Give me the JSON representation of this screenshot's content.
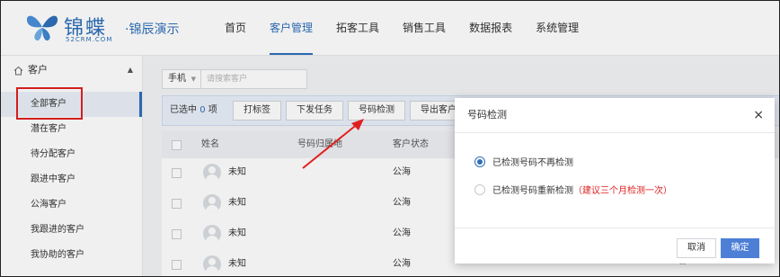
{
  "header": {
    "brand": "锦蝶",
    "brand_sub": "52CRM.COM",
    "product": "·锦辰演示",
    "nav": [
      "首页",
      "客户管理",
      "拓客工具",
      "销售工具",
      "数据报表",
      "系统管理"
    ],
    "active_nav": "客户管理"
  },
  "sidebar": {
    "section": "客户",
    "items": [
      "全部客户",
      "潜在客户",
      "待分配客户",
      "跟进中客户",
      "公海客户",
      "我跟进的客户",
      "我协助的客户"
    ]
  },
  "filter": {
    "select_value": "手机",
    "search_placeholder": "请搜索客户"
  },
  "actionbar": {
    "selected_prefix": "已选中",
    "selected_count": "0",
    "selected_suffix": "项",
    "buttons": [
      "打标签",
      "下发任务",
      "号码检测",
      "导出客户"
    ]
  },
  "table": {
    "headers": [
      "姓名",
      "号码归属地",
      "客户状态"
    ],
    "rows": [
      {
        "name": "未知",
        "status": "公海",
        "extra": ""
      },
      {
        "name": "未知",
        "status": "公海",
        "extra": ""
      },
      {
        "name": "未知",
        "status": "公海",
        "extra": ""
      },
      {
        "name": "未知",
        "status": "公海",
        "extra": "--"
      }
    ]
  },
  "modal": {
    "title": "号码检测",
    "close": "×",
    "option1": "已检测号码不再检测",
    "option2": "已检测号码重新检测",
    "option2_tip": "（建议三个月检测一次）",
    "cancel": "取消",
    "ok": "确定"
  },
  "colors": {
    "accent": "#2e6fb8",
    "highlight": "#e02020"
  }
}
